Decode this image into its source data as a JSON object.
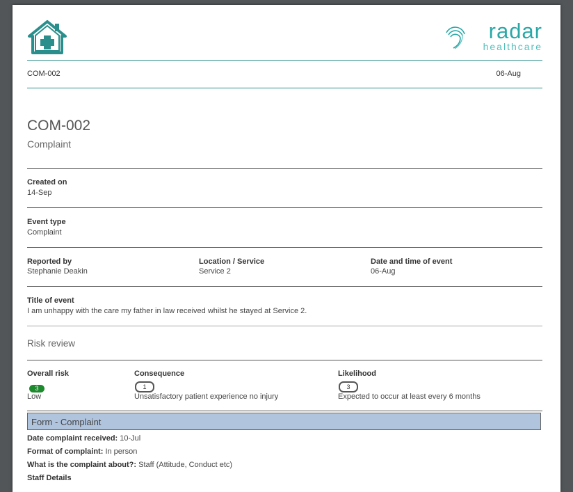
{
  "header": {
    "brand_name": "radar",
    "brand_sub": "healthcare",
    "ref": "COM-002",
    "date": "06-Aug",
    "colors": {
      "teal": "#2a8f8c",
      "brand": "#2aa8a8"
    }
  },
  "record": {
    "id": "COM-002",
    "type": "Complaint"
  },
  "fields": {
    "created_on_label": "Created on",
    "created_on_value": "14-Sep",
    "event_type_label": "Event type",
    "event_type_value": "Complaint",
    "reported_by_label": "Reported by",
    "reported_by_value": "Stephanie Deakin",
    "location_label": "Location / Service",
    "location_value": "Service 2",
    "datetime_label": "Date and time of event",
    "datetime_value": "06-Aug",
    "title_label": "Title of event",
    "title_value": "I am unhappy with the care my father in law received whilst he stayed at Service 2."
  },
  "risk": {
    "heading": "Risk review",
    "overall_label": "Overall risk",
    "overall_score": "3",
    "overall_text": "Low",
    "overall_color": "#1e8a2e",
    "consequence_label": "Consequence",
    "consequence_score": "1",
    "consequence_text": "Unsatisfactory patient experience no injury",
    "likelihood_label": "Likelihood",
    "likelihood_score": "3",
    "likelihood_text": "Expected to occur at least every 6 months"
  },
  "form": {
    "heading": "Form - Complaint",
    "heading_color": "#b0c4de",
    "rows": [
      {
        "label": "Date complaint received:",
        "value": "10-Jul"
      },
      {
        "label": "Format of complaint:",
        "value": "In person"
      },
      {
        "label": "What is the complaint about?:",
        "value": "Staff (Attitude, Conduct etc)"
      }
    ],
    "next_section": "Staff Details"
  }
}
